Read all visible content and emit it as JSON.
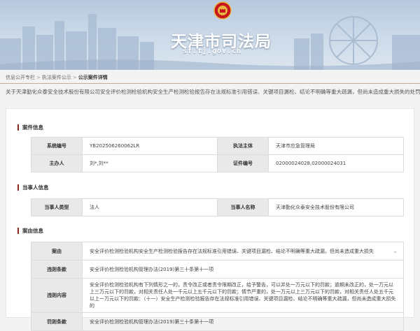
{
  "site": {
    "title": "天津市司法局",
    "domain": "sf.tj.gov.cn"
  },
  "breadcrumb": {
    "items": [
      "信息公开专栏",
      "执法案件公示",
      "公示案件详情"
    ]
  },
  "headline": "关于天津勤化众泰安全技术股份有限公司安全评价检测检验机构安全生产检测检验报告存在法规标准引用错误、关键项目漏检、结论不明确等重大疏漏，但尚未造成重大损失的处罚",
  "sections": {
    "case_info": "案件信息",
    "party_info": "当事人信息",
    "details": "案由信息"
  },
  "case_info": {
    "rows": [
      {
        "k1": "系统编号",
        "v1": "YB202506260062LR",
        "k2": "执法主体",
        "v2": "天津市应急管理局"
      },
      {
        "k1": "主办人",
        "v1": "刘*,刘**",
        "k2": "证件编号",
        "v2": "02000024028,02000024031"
      }
    ]
  },
  "party_info": {
    "k1": "当事人类型",
    "v1": "法人",
    "k2": "当事人名称",
    "v2": "天津勤化众泰安全技术股份有限公司"
  },
  "details": {
    "reason_label": "案由",
    "reason": "安全评价检测检验机构安全生产检测检验报告存在法规标准引用错误、关键项目漏检、结论不明确等重大疏漏，但尚未造成重大损失",
    "violated_label": "违则条款",
    "violated": "安全评价检测检验机构管理办法(2019)第三十条第十一项",
    "violation_label": "违则内容",
    "violation": "安全评价检测检验机构有下列情形之一的，责令改正或者责令限期改正，给予警告，可以并处一万元以下的罚款；逾期未改正的，处一万元以上三万元以下的罚款，对相关责任人处一千元以上五千元以下的罚款；情节严重的，处一万元以上三万元以下的罚款，对相关责任人处五千元以上一万元以下的罚款：（十一）安全生产检测检验报告存在法规标准引用错误、关键项目漏检、结论不明确等重大疏漏，但尚未造成重大损失的",
    "penalty_basis_label": "罚则条款",
    "penalty_basis": "安全评价检测检验机构管理办法(2019)第三十条第十一项"
  }
}
